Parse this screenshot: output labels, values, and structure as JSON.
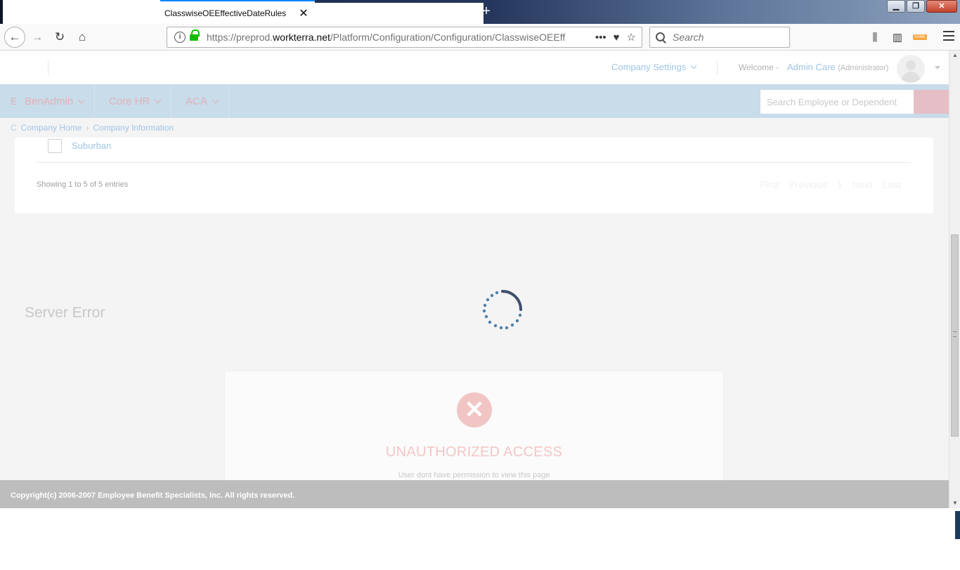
{
  "browser": {
    "tab_title": "ClasswiseOEEffectiveDateRules",
    "new_tab": "+",
    "url_prefix": "https://preprod.",
    "url_domain": "workterra.net",
    "url_path": "/Platform/Configuration/Configuration/ClasswiseOEEff",
    "search_placeholder": "Search",
    "page_actions": "•••",
    "window_minimize": "▁",
    "window_restore": "❐",
    "window_close": "✕"
  },
  "header": {
    "company_settings": "Company Settings",
    "welcome": "Welcome -",
    "admin_name": "Admin Care",
    "admin_role": "(Administrator)"
  },
  "nav": {
    "edge_label": "E",
    "items": [
      {
        "label": "BenAdmin"
      },
      {
        "label": "Core HR"
      },
      {
        "label": "ACA"
      }
    ],
    "search_placeholder": "Search Employee or Dependent"
  },
  "breadcrumb": {
    "edge": "C",
    "items": [
      "Company Home",
      "Company Information"
    ],
    "separator": "›"
  },
  "table": {
    "row_label": "Suburban",
    "entries_text": "Showing 1 to 5 of 5 entries",
    "pager": [
      "First",
      "Previous",
      "1",
      "Next",
      "Last"
    ]
  },
  "server_error": "Server Error",
  "error_dialog": {
    "icon": "close-circle-icon",
    "title": "UNAUTHORIZED ACCESS",
    "message": "User dont have permission to view this page"
  },
  "footer": {
    "copyright": "Copyright(c) 2006-2007 Employee Benefit Specialists, Inc. All rights reserved."
  },
  "colors": {
    "nav_bg": "#c8dcea",
    "link": "#9fc4e6",
    "error": "#f2c5c5",
    "footer": "#bdbdbd"
  }
}
